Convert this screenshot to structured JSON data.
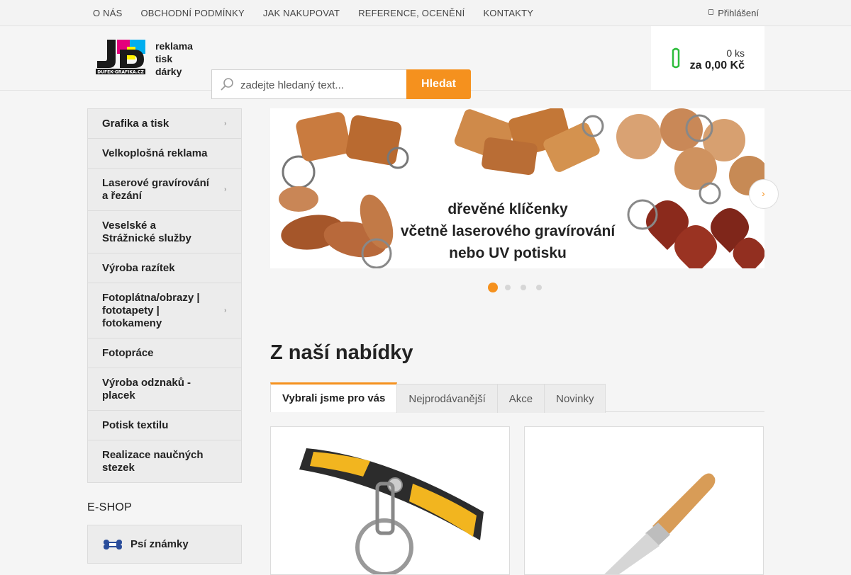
{
  "topnav": {
    "items": [
      "O NÁS",
      "OBCHODNÍ PODMÍNKY",
      "JAK NAKUPOVAT",
      "REFERENCE, OCENĚNÍ",
      "KONTAKTY"
    ],
    "login": "Přihlášení"
  },
  "logo": {
    "line1": "reklama",
    "line2": "tisk",
    "line3": "dárky",
    "small": "DUFEK-GRAFIKA.CZ"
  },
  "search": {
    "placeholder": "zadejte hledaný text...",
    "button": "Hledat"
  },
  "cart": {
    "count": "0 ks",
    "price": "za 0,00 Kč"
  },
  "sidebar": {
    "categories": [
      "Grafika a tisk",
      "Velkoplošná reklama",
      "Laserové gravírování a řezání",
      "Veselské a Strážnické služby",
      "Výroba razítek",
      "Fotoplátna/obrazy | fototapety | fotokameny",
      "Fotopráce",
      "Výroba odznaků - placek",
      "Potisk textilu",
      "Realizace naučných stezek"
    ],
    "eshop_title": "E-SHOP",
    "eshop_items": [
      "Psí známky"
    ]
  },
  "banner": {
    "line1": "dřevěné klíčenky",
    "line2": "včetně laserového gravírování",
    "line3": "nebo UV potisku"
  },
  "offer": {
    "title": "Z naší nabídky",
    "tabs": [
      "Vybrali jsme pro vás",
      "Nejprodávanější",
      "Akce",
      "Novinky"
    ]
  },
  "colors": {
    "accent": "#f5911e",
    "cart_icon": "#2ebd3c"
  }
}
